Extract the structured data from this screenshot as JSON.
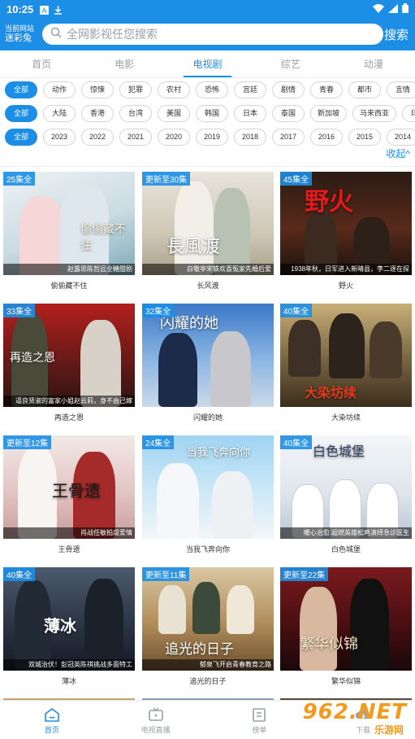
{
  "statusbar": {
    "time": "10:25"
  },
  "header": {
    "site_label": "当前网站",
    "site_name": "迷彩兔",
    "search_placeholder": "全网影视任您搜索",
    "search_button": "搜索"
  },
  "tabs": [
    "首页",
    "电影",
    "电视剧",
    "综艺",
    "动漫"
  ],
  "filters": {
    "row1": [
      "全部",
      "动作",
      "惊悚",
      "犯罪",
      "农村",
      "恐怖",
      "宫廷",
      "剧情",
      "青春",
      "都市",
      "言情"
    ],
    "row2": [
      "全部",
      "大陆",
      "香港",
      "台湾",
      "美国",
      "韩国",
      "日本",
      "泰国",
      "新加坡",
      "马来西亚",
      "印度"
    ],
    "row3": [
      "全部",
      "2023",
      "2022",
      "2021",
      "2020",
      "2019",
      "2018",
      "2017",
      "2016",
      "2015",
      "2014"
    ],
    "collapse": "收起^"
  },
  "items": [
    {
      "badge": "25集全",
      "caption": "赵露思陈哲远全糖甜剧",
      "name": "偷偷藏不住",
      "poster_text": "偷偷藏不住"
    },
    {
      "badge": "更新至30集",
      "caption": "白敬亭宋轶欢喜冤家先婚后爱",
      "name": "长风渡",
      "poster_text": "長風渡"
    },
    {
      "badge": "45集全",
      "caption": "1938年秋，日军进入新晴县，李二逐在探",
      "name": "野火",
      "poster_text": "野火"
    },
    {
      "badge": "33集全",
      "caption": "逼良贤淑的富家小姐赵云莉，身不由己嫁",
      "name": "再造之恩",
      "poster_text": "再造之恩"
    },
    {
      "badge": "32集全",
      "caption": "",
      "name": "闪耀的她",
      "poster_text": "闪耀的她"
    },
    {
      "badge": "40集全",
      "caption": "",
      "name": "大染坊续",
      "poster_text": "大染坊续"
    },
    {
      "badge": "更新至12集",
      "caption": "肖战任敏拍虐爱情",
      "name": "王骨遗",
      "poster_text": "王骨遗"
    },
    {
      "badge": "24集全",
      "caption": "",
      "name": "当我飞奔向你",
      "poster_text": "当我飞奔向你"
    },
    {
      "badge": "40集全",
      "caption": "暖心治愈 超燃英雄松鸡演绎急诊医生",
      "name": "白色城堡",
      "poster_text": "白色城堡"
    },
    {
      "badge": "40集全",
      "caption": "双城治伏！彭冠英陈祺挑战多面特工",
      "name": "薄冰",
      "poster_text": "薄冰"
    },
    {
      "badge": "更新至11集",
      "caption": "郁泉飞开启青春教育之路",
      "name": "追光的日子",
      "poster_text": "追光的日子"
    },
    {
      "badge": "更新至22集",
      "caption": "",
      "name": "繁华似锦",
      "poster_text": "繁华似锦"
    }
  ],
  "bottomnav": [
    "首页",
    "电视直播",
    "榜单",
    "下载"
  ],
  "watermark": {
    "line1": "962.NET",
    "line2": "乐游网"
  }
}
